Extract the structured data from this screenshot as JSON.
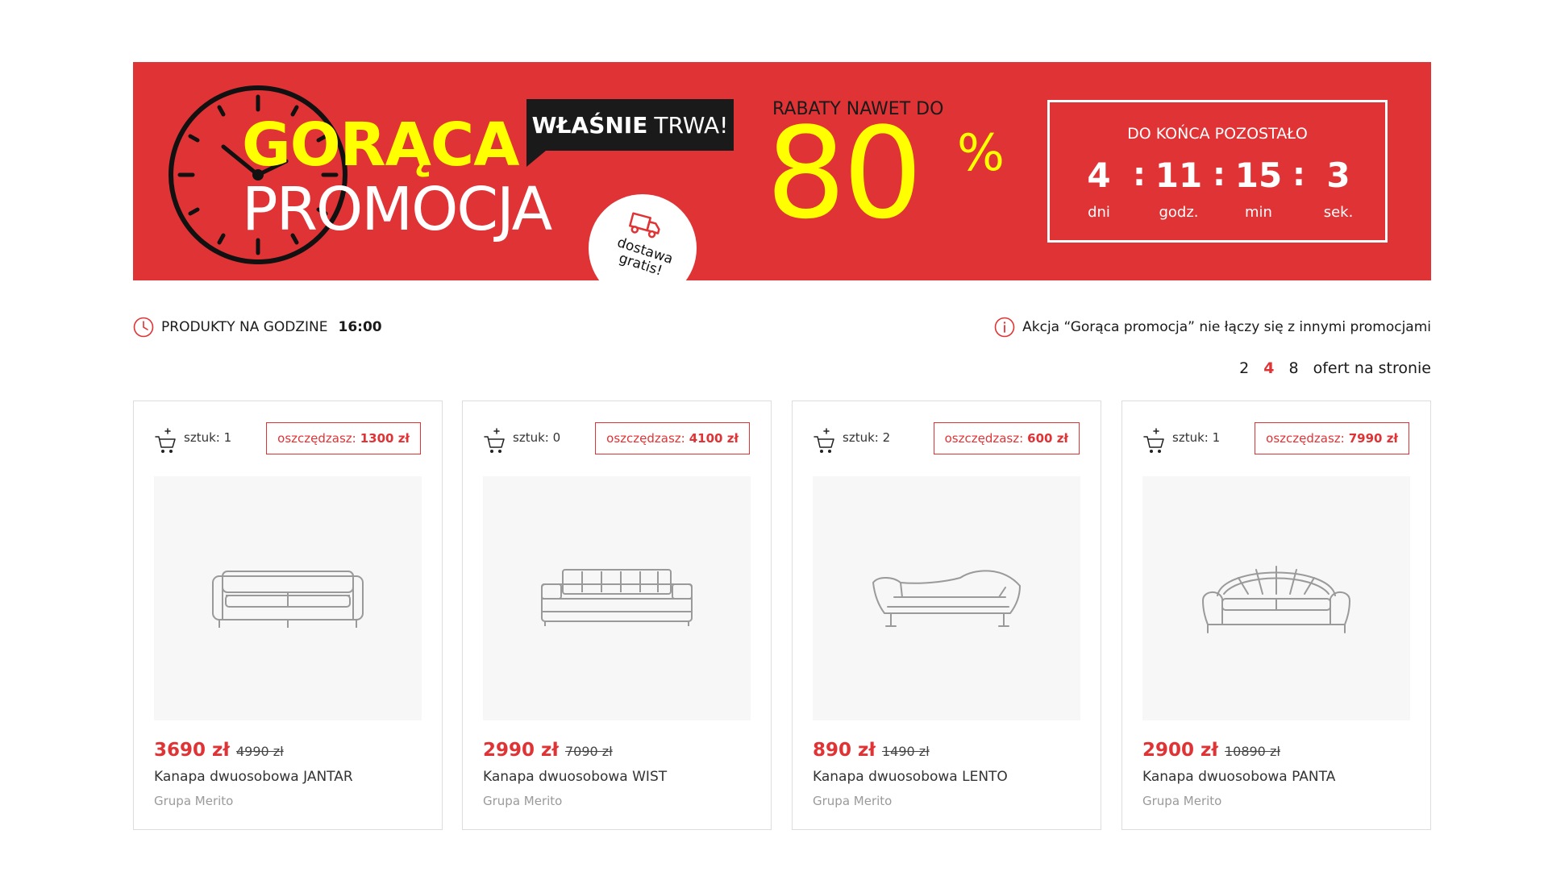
{
  "colors": {
    "accent": "#e03335",
    "promo_yellow": "#ffff00",
    "badge_dark": "#1a1a1a"
  },
  "banner": {
    "title_line1": "GORĄCA",
    "title_line2": "PROMOCJA",
    "live_strong": "WŁAŚNIE",
    "live_rest": "TRWA!",
    "delivery_text": "dostawa gratis!",
    "discount_label": "RABATY NAWET DO",
    "discount_value": "80",
    "discount_sign": "%",
    "countdown": {
      "label": "DO KOŃCA POZOSTAŁO",
      "separator": ":",
      "units": [
        {
          "value": "4",
          "label": "dni"
        },
        {
          "value": "11",
          "label": "godz."
        },
        {
          "value": "15",
          "label": "min"
        },
        {
          "value": "3",
          "label": "sek."
        }
      ]
    }
  },
  "info": {
    "hours_label": "PRODUKTY NA GODZINE",
    "hours_time": "16:00",
    "notice": "Akcja “Gorąca promocja” nie łączy się z innymi promocjami"
  },
  "pagination": {
    "options": [
      "2",
      "4",
      "8"
    ],
    "selected": "4",
    "suffix": "ofert na stronie"
  },
  "products": [
    {
      "stock": "sztuk: 1",
      "save_label": "oszczędzasz:",
      "save_value": "1300 zł",
      "price": "3690 zł",
      "old_price": "4990 zł",
      "name": "Kanapa dwuosobowa JANTAR",
      "brand": "Grupa Merito",
      "icon": "sofa-icon"
    },
    {
      "stock": "sztuk: 0",
      "save_label": "oszczędzasz:",
      "save_value": "4100 zł",
      "price": "2990 zł",
      "old_price": "7090 zł",
      "name": "Kanapa dwuosobowa WIST",
      "brand": "Grupa Merito",
      "icon": "sofa-icon"
    },
    {
      "stock": "sztuk: 2",
      "save_label": "oszczędzasz:",
      "save_value": "600 zł",
      "price": "890 zł",
      "old_price": "1490 zł",
      "name": "Kanapa dwuosobowa LENTO",
      "brand": "Grupa Merito",
      "icon": "sofa-icon"
    },
    {
      "stock": "sztuk: 1",
      "save_label": "oszczędzasz:",
      "save_value": "7990 zł",
      "price": "2900 zł",
      "old_price": "10890 zł",
      "name": "Kanapa dwuosobowa PANTA",
      "brand": "Grupa Merito",
      "icon": "sofa-icon"
    }
  ]
}
